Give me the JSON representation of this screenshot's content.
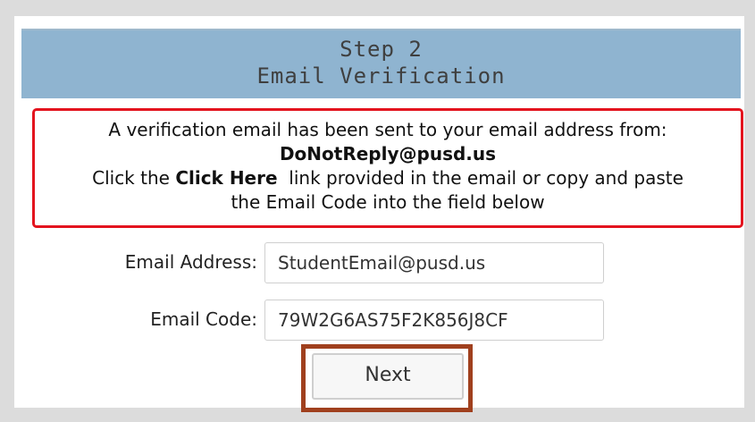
{
  "header": {
    "step": "Step 2",
    "title": "Email Verification"
  },
  "notice": {
    "line1": "A verification email has been sent to your email address from:",
    "sender": "DoNotReply@pusd.us",
    "line3_prefix": "Click the ",
    "line3_link_text": "Click Here",
    "line3_suffix": "  link provided in the email or copy and paste",
    "line4": "the Email Code into the field below",
    "border_color": "#e3141e"
  },
  "form": {
    "email_label": "Email Address:",
    "email_value": "StudentEmail@pusd.us",
    "code_label": "Email Code:",
    "code_value": "79W2G6AS75F2K856J8CF"
  },
  "actions": {
    "next_label": "Next",
    "highlight_color": "#a0401e"
  },
  "colors": {
    "header_bg": "#8fb4d0",
    "page_bg": "#dcdcdc"
  }
}
